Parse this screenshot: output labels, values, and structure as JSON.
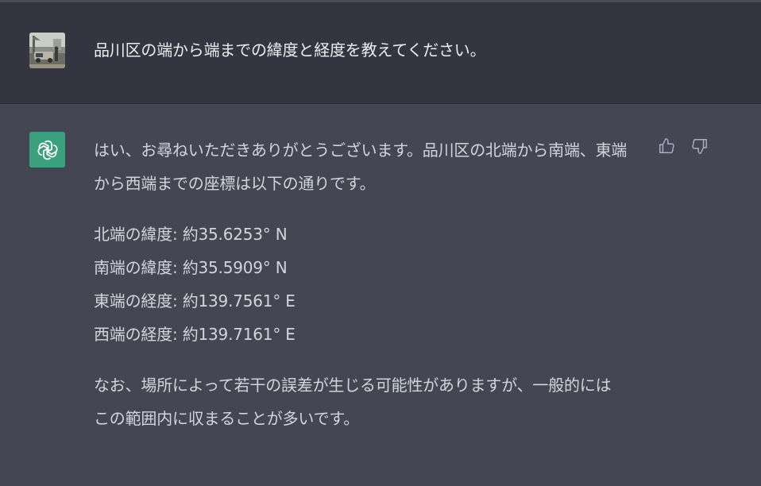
{
  "user": {
    "message": "品川区の端から端までの緯度と経度を教えてください。"
  },
  "assistant": {
    "intro_line1": "はい、お尋ねいただきありがとうございます。品川区の北端から南端、東端",
    "intro_line2": "から西端までの座標は以下の通りです。",
    "coords": [
      "北端の緯度: 約35.6253° N",
      "南端の緯度: 約35.5909° N",
      "東端の経度: 約139.7561° E",
      "西端の経度: 約139.7161° E"
    ],
    "note_line1": "なお、場所によって若干の誤差が生じる可能性がありますが、一般的には",
    "note_line2": "この範囲内に収まることが多いです。"
  },
  "icons": {
    "user_avatar": "user-photo-avatar",
    "bot_avatar": "openai-logo-icon",
    "like": "thumbs-up-icon",
    "dislike": "thumbs-down-icon"
  },
  "colors": {
    "user_bg": "#343541",
    "assistant_bg": "#444654",
    "bot_avatar_bg": "#3aa07e"
  }
}
